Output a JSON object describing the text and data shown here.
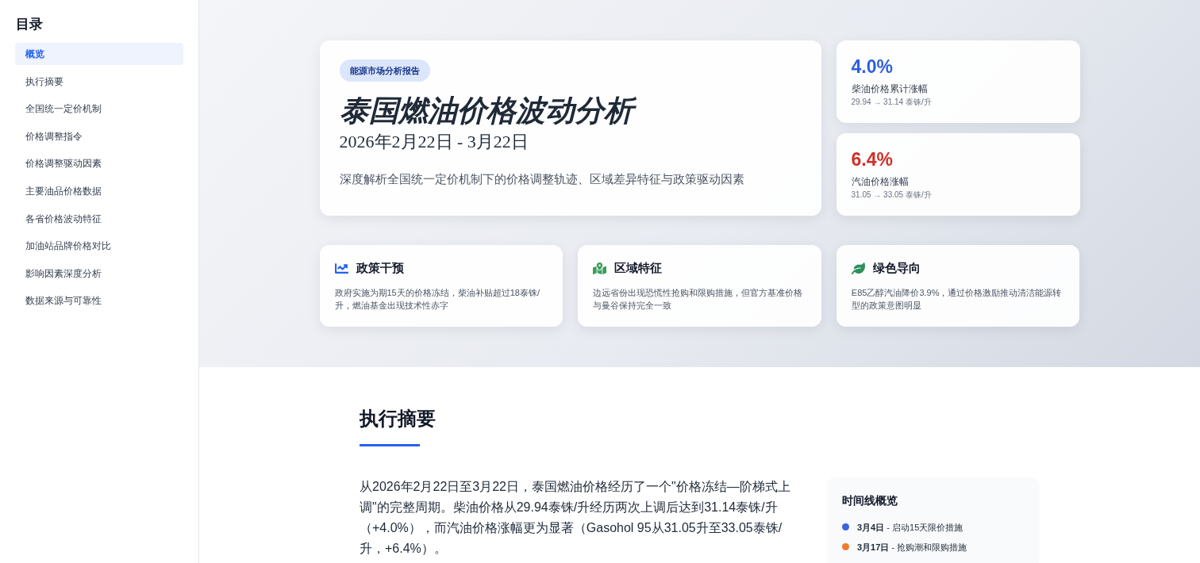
{
  "sidebar": {
    "title": "目录",
    "items": [
      {
        "label": "概览",
        "selected": true
      },
      {
        "label": "执行摘要",
        "selected": false
      },
      {
        "label": "全国统一定价机制",
        "selected": false
      },
      {
        "label": "价格调整指令",
        "selected": false
      },
      {
        "label": "价格调整驱动因素",
        "selected": false
      },
      {
        "label": "主要油品价格数据",
        "selected": false
      },
      {
        "label": "各省价格波动特征",
        "selected": false
      },
      {
        "label": "加油站品牌价格对比",
        "selected": false
      },
      {
        "label": "影响因素深度分析",
        "selected": false
      },
      {
        "label": "数据来源与可靠性",
        "selected": false
      }
    ]
  },
  "hero": {
    "badge": "能源市场分析报告",
    "title": "泰国燃油价格波动分析",
    "date_range": "2026年2月22日 - 3月22日",
    "subtitle": "深度解析全国统一定价机制下的价格调整轨迹、区域差异特征与政策驱动因素"
  },
  "stats": [
    {
      "value": "4.0%",
      "color": "#2f5fe0",
      "label": "柴油价格累计涨幅",
      "detail": "29.94 → 31.14 泰铢/升"
    },
    {
      "value": "6.4%",
      "color": "#d22f27",
      "label": "汽油价格涨幅",
      "detail": "31.05 → 33.05 泰铢/升"
    }
  ],
  "highlights": [
    {
      "kind": "policy",
      "title": "政策干预",
      "text": "政府实施为期15天的价格冻结，柴油补贴超过18泰铢/升，燃油基金出现技术性赤字"
    },
    {
      "kind": "region",
      "title": "区域特征",
      "text": "边远省份出现恐慌性抢购和限购措施，但官方基准价格与曼谷保持完全一致"
    },
    {
      "kind": "environment",
      "title": "绿色导向",
      "text": "E85乙醇汽油降价3.9%，通过价格激励推动清洁能源转型的政策意图明显"
    }
  ],
  "summary": {
    "heading": "执行摘要",
    "paragraph": "从2026年2月22日至3月22日，泰国燃油价格经历了一个\"价格冻结—阶梯式上调\"的完整周期。柴油价格从29.94泰铢/升经历两次上调后达到31.14泰铢/升（+4.0%），而汽油价格涨幅更为显著（Gasohol 95从31.05升至33.05泰铢/升，+6.4%）。",
    "timeline": {
      "title": "时间线概览",
      "items": [
        {
          "text": "**3月4日** - 启动15天限价措施",
          "color": "#3b63e0"
        },
        {
          "text": "**3月17日** - 抢购潮和限购措施",
          "color": "#ef7b2f"
        }
      ]
    }
  }
}
